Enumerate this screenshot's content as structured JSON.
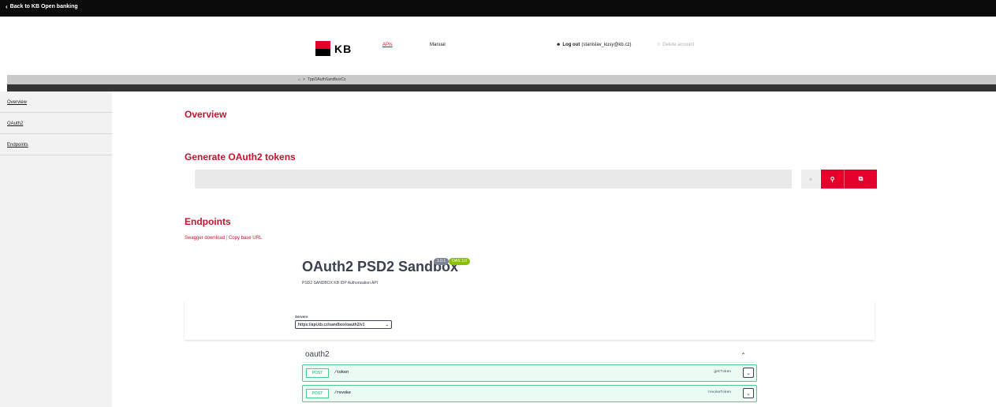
{
  "topbar": {
    "back_label": "Back to KB Open banking"
  },
  "header": {
    "logo_text": "KB",
    "nav": {
      "apis": "APIs",
      "manual": "Manual"
    },
    "logout_label": "Log out",
    "user_email": "(stanislav_kusy@kb.cz)",
    "delete_label": "Delete account"
  },
  "breadcrumb": {
    "current": "TppOAuthSandboxCz"
  },
  "sidebar": {
    "items": [
      {
        "label": "Overview"
      },
      {
        "label": "OAuth2"
      },
      {
        "label": "Endpoints"
      }
    ]
  },
  "main": {
    "overview_title": "Overview",
    "generate_title": "Generate OAuth2 tokens",
    "endpoints_title": "Endpoints",
    "swagger_link": "Swagger download",
    "separator": "|",
    "copy_link": "Copy base URL"
  },
  "api": {
    "title": "OAuth2 PSD2 Sandbox",
    "version_badge": "1.0.1",
    "oas_badge": "OAS 3.0",
    "description": "PSD2 SANDBOX KB IDP Authorization API",
    "servers_label": "Servers",
    "server_url": "https://api.kb.cz/sandbox/oauth2/v1",
    "tag": "oauth2",
    "operations": [
      {
        "method": "POST",
        "path": "/token",
        "operation_id": "getToken"
      },
      {
        "method": "POST",
        "path": "/revoke",
        "operation_id": "revokeToken"
      }
    ]
  },
  "colors": {
    "brand_red": "#e4002b",
    "heading_red": "#c8102e",
    "post_green": "#49cc90"
  },
  "icons": [
    "chevron-left-icon",
    "home-icon",
    "chevron-right-icon",
    "user-icon",
    "user-delete-icon",
    "key-icon",
    "copy-icon",
    "refresh-icon",
    "chevron-down-icon",
    "chevron-up-icon"
  ]
}
